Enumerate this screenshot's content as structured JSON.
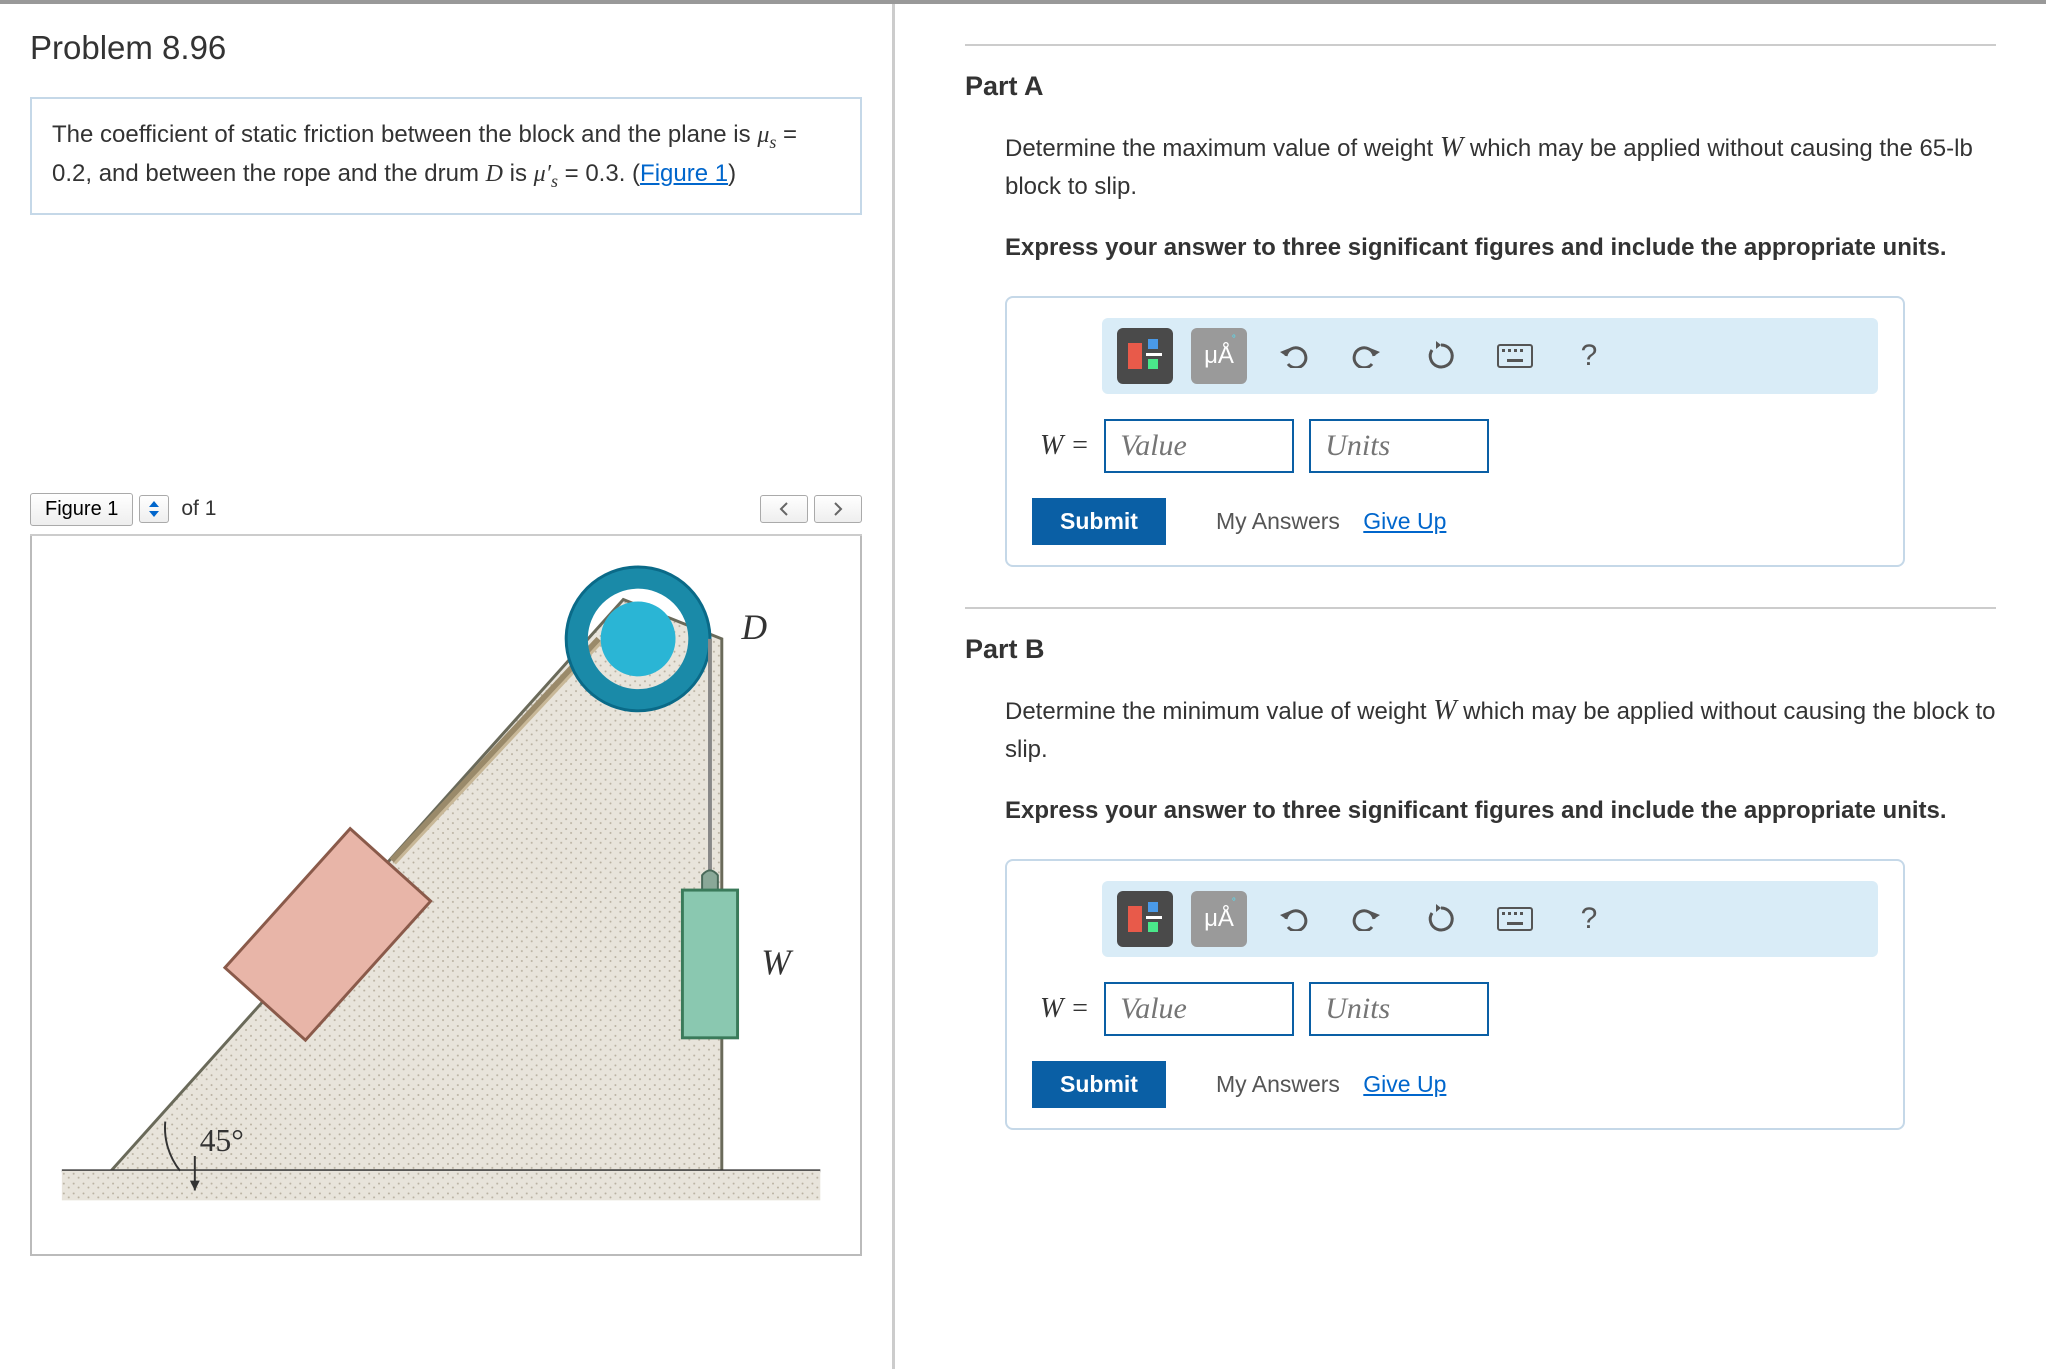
{
  "problem": {
    "title": "Problem 8.96",
    "statement_pre": "The coefficient of static friction between the block and the plane is ",
    "mu_s_eq": "μ",
    "mu_s_sub": "s",
    "mu_s_val": " = 0.2",
    "statement_mid": ", and between the rope and the drum ",
    "drum_var": "D",
    "statement_mid2": " is ",
    "mu_sp_eq": "μ′",
    "mu_sp_sub": "s",
    "mu_sp_val": " = 0.3",
    "statement_post": ". (",
    "figure_link": "Figure 1",
    "statement_end": ")"
  },
  "figure": {
    "label": "Figure 1",
    "of": "of 1",
    "angle": "45°",
    "drum_label": "D",
    "weight_label": "W"
  },
  "partA": {
    "title": "Part A",
    "desc_pre": "Determine the maximum value of weight ",
    "var": "W",
    "desc_post": " which may be applied without causing the 65-lb block to slip.",
    "instruction": "Express your answer to three significant figures and include the appropriate units.",
    "var_eq": "W =",
    "value_ph": "Value",
    "units_ph": "Units",
    "submit": "Submit",
    "my_answers": "My Answers",
    "give_up": "Give Up",
    "mu_tool": "μÅ",
    "help": "?"
  },
  "partB": {
    "title": "Part B",
    "desc_pre": "Determine the minimum value of weight ",
    "var": "W",
    "desc_post": " which may be applied without causing the block to slip.",
    "instruction": "Express your answer to three significant figures and include the appropriate units.",
    "var_eq": "W =",
    "value_ph": "Value",
    "units_ph": "Units",
    "submit": "Submit",
    "my_answers": "My Answers",
    "give_up": "Give Up",
    "mu_tool": "μÅ",
    "help": "?"
  }
}
